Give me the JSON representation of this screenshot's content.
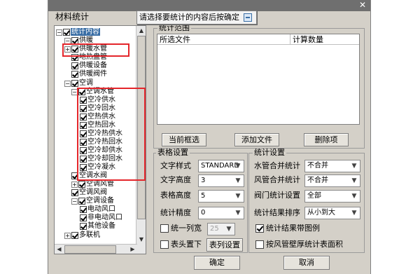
{
  "window": {
    "tab_title": "材料统计",
    "tooltip": "请选择要统计的内容后按确定"
  },
  "tree": {
    "items": [
      {
        "label": "统计内容",
        "checked": true,
        "expander": "-"
      },
      {
        "label": "供暖",
        "checked": true,
        "expander": "-"
      },
      {
        "label": "供暖水管",
        "checked": true,
        "expander": "+"
      },
      {
        "label": "地热盘管",
        "checked": true,
        "expander": ""
      },
      {
        "label": "供暖设备",
        "checked": true,
        "expander": ""
      },
      {
        "label": "供暖阀件",
        "checked": true,
        "expander": ""
      },
      {
        "label": "空调",
        "checked": true,
        "expander": "-"
      },
      {
        "label": "空调水管",
        "checked": true,
        "expander": "-"
      },
      {
        "label": "空冷供水",
        "checked": true,
        "expander": ""
      },
      {
        "label": "空冷回水",
        "checked": true,
        "expander": ""
      },
      {
        "label": "空热供水",
        "checked": true,
        "expander": ""
      },
      {
        "label": "空热回水",
        "checked": true,
        "expander": ""
      },
      {
        "label": "空冷热供水",
        "checked": true,
        "expander": ""
      },
      {
        "label": "空冷热回水",
        "checked": true,
        "expander": ""
      },
      {
        "label": "空冷却供水",
        "checked": true,
        "expander": ""
      },
      {
        "label": "空冷却回水",
        "checked": true,
        "expander": ""
      },
      {
        "label": "空冷凝水",
        "checked": true,
        "expander": ""
      },
      {
        "label": "空调水阀",
        "checked": true,
        "expander": ""
      },
      {
        "label": "空调风管",
        "checked": true,
        "expander": "+"
      },
      {
        "label": "空调风阀",
        "checked": true,
        "expander": ""
      },
      {
        "label": "空调设备",
        "checked": true,
        "expander": "-"
      },
      {
        "label": "电动风口",
        "checked": true,
        "expander": ""
      },
      {
        "label": "非电动风口",
        "checked": true,
        "expander": ""
      },
      {
        "label": "其他设备",
        "checked": true,
        "expander": ""
      },
      {
        "label": "多联机",
        "checked": true,
        "expander": "+"
      }
    ]
  },
  "stat_range": {
    "title": "统计范围",
    "col_file": "所选文件",
    "col_count": "计算数量",
    "btn_current": "当前框选",
    "btn_add": "添加文件",
    "btn_delete": "删除项"
  },
  "table_settings": {
    "title": "表格设置",
    "font_style_label": "文字样式",
    "font_style_value": "STANDARD",
    "text_height_label": "文字高度",
    "text_height_value": "3",
    "table_height_label": "表格高度",
    "table_height_value": "5",
    "precision_label": "统计精度",
    "precision_value": "0",
    "uniform_width_label": "统一列宽",
    "uniform_width_value": "25",
    "header_bottom_label": "表头置下",
    "column_settings_button": "表列设置"
  },
  "stat_settings": {
    "title": "统计设置",
    "water_merge_label": "水管合并统计",
    "water_merge_value": "不合并",
    "duct_merge_label": "风管合并统计",
    "duct_merge_value": "不合并",
    "valve_setting_label": "阀门统计设置",
    "valve_setting_value": "全部",
    "sort_label": "统计结果排序",
    "sort_value": "从小到大",
    "with_legend_label": "统计结果带图例",
    "with_legend_checked": true,
    "by_thickness_label": "按风管壁厚统计表面积",
    "by_thickness_checked": false
  },
  "footer": {
    "ok": "确定",
    "cancel": "取消"
  },
  "colors": {
    "dialog_bg": "#d4d0c8",
    "highlight_red": "#e4262b",
    "selection_blue": "#3a6ea5"
  }
}
